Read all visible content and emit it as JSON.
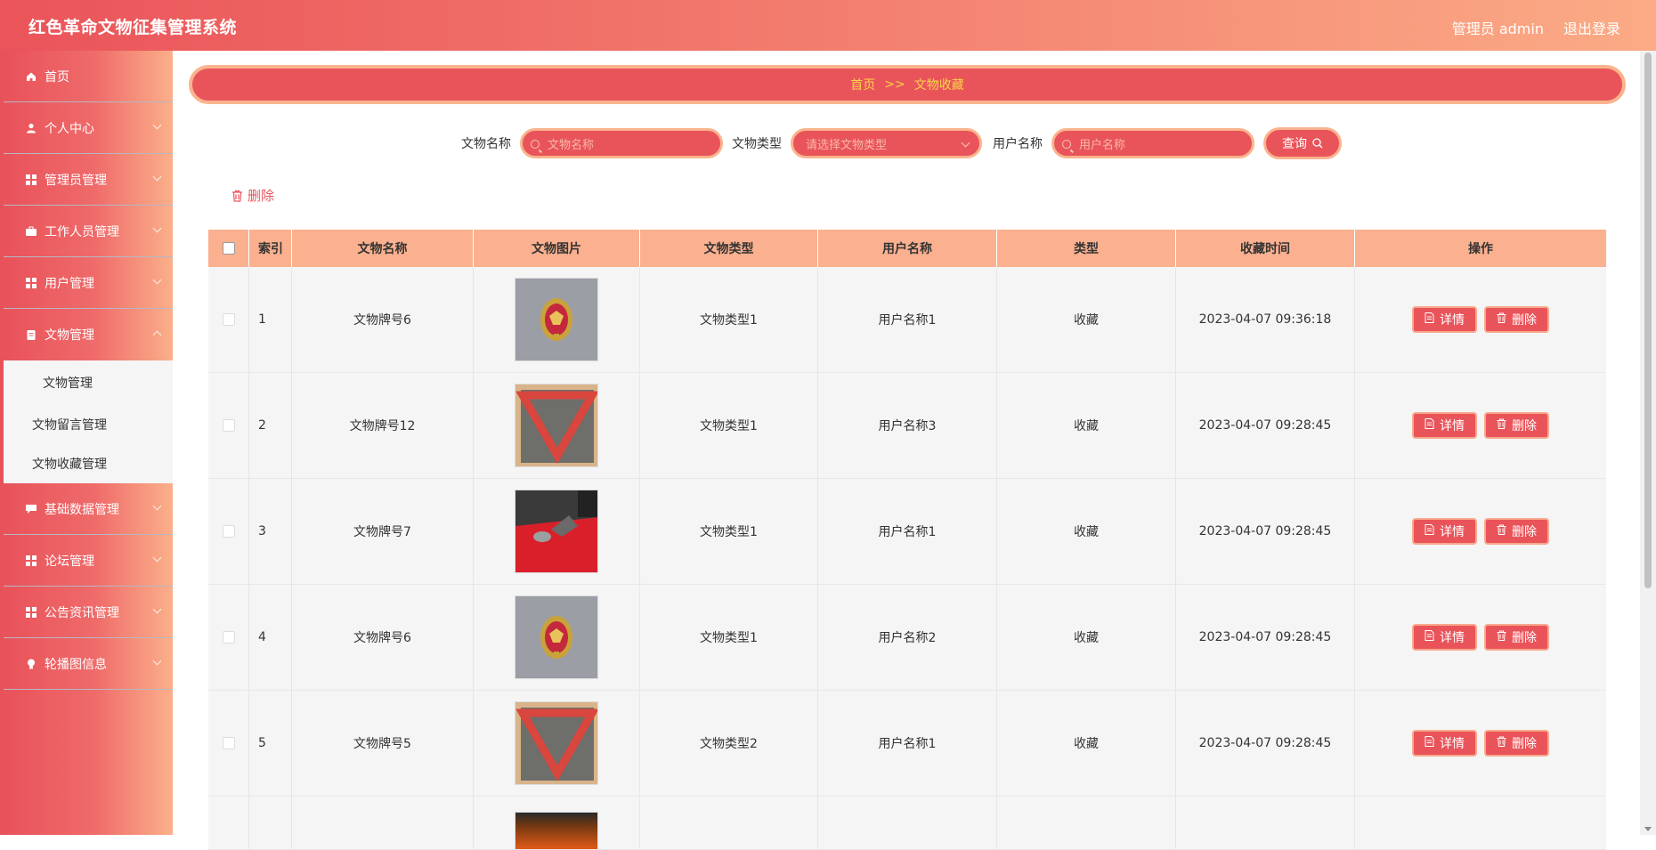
{
  "header": {
    "title": "红色革命文物征集管理系统",
    "user_label": "管理员 admin",
    "logout_label": "退出登录"
  },
  "sidebar": {
    "items": [
      {
        "label": "首页",
        "icon": "home-icon"
      },
      {
        "label": "个人中心",
        "icon": "user-icon"
      },
      {
        "label": "管理员管理",
        "icon": "grid-icon"
      },
      {
        "label": "工作人员管理",
        "icon": "briefcase-icon"
      },
      {
        "label": "用户管理",
        "icon": "grid-icon"
      },
      {
        "label": "文物管理",
        "icon": "clipboard-icon"
      },
      {
        "label": "基础数据管理",
        "icon": "chat-icon"
      },
      {
        "label": "论坛管理",
        "icon": "grid-icon"
      },
      {
        "label": "公告资讯管理",
        "icon": "grid-icon"
      },
      {
        "label": "轮播图信息",
        "icon": "bulb-icon"
      }
    ],
    "submenu": [
      "文物管理",
      "文物留言管理",
      "文物收藏管理"
    ]
  },
  "breadcrumb": {
    "home": "首页",
    "separator": ">>",
    "current": "文物收藏"
  },
  "search": {
    "name_label": "文物名称",
    "name_placeholder": "文物名称",
    "type_label": "文物类型",
    "type_placeholder": "请选择文物类型",
    "user_label": "用户名称",
    "user_placeholder": "用户名称",
    "query_label": "查询"
  },
  "bulk_delete_label": "删除",
  "table": {
    "headers": [
      "索引",
      "文物名称",
      "文物图片",
      "文物类型",
      "用户名称",
      "类型",
      "收藏时间",
      "操作"
    ],
    "rows": [
      {
        "idx": "1",
        "name": "文物牌号6",
        "type": "文物类型1",
        "user": "用户名称1",
        "kind": "收藏",
        "time": "2023-04-07 09:36:18",
        "image": "badge"
      },
      {
        "idx": "2",
        "name": "文物牌号12",
        "type": "文物类型1",
        "user": "用户名称3",
        "kind": "收藏",
        "time": "2023-04-07 09:28:45",
        "image": "scarf"
      },
      {
        "idx": "3",
        "name": "文物牌号7",
        "type": "文物类型1",
        "user": "用户名称1",
        "kind": "收藏",
        "time": "2023-04-07 09:28:45",
        "image": "cloth"
      },
      {
        "idx": "4",
        "name": "文物牌号6",
        "type": "文物类型1",
        "user": "用户名称2",
        "kind": "收藏",
        "time": "2023-04-07 09:28:45",
        "image": "badge"
      },
      {
        "idx": "5",
        "name": "文物牌号5",
        "type": "文物类型2",
        "user": "用户名称1",
        "kind": "收藏",
        "time": "2023-04-07 09:28:45",
        "image": "scarf"
      }
    ],
    "detail_label": "详情",
    "delete_label": "删除"
  },
  "colors": {
    "accent": "#e9545a",
    "accent_light": "#f9b48e",
    "breadcrumb_text": "#f9d24a"
  }
}
